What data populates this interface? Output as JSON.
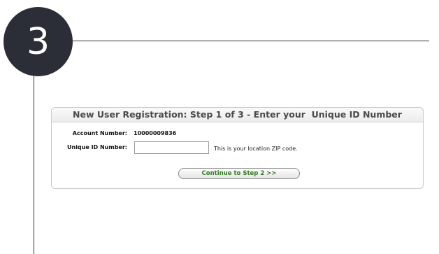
{
  "step_badge": {
    "number": "3"
  },
  "registration": {
    "title": "New User Registration: Step 1 of 3 - Enter your  Unique ID Number",
    "account_label": "Account Number:",
    "account_value": "10000009836",
    "unique_id_label": "Unique ID Number:",
    "unique_id_value": "",
    "unique_id_hint": "This is your location ZIP code.",
    "continue_label": "Continue to Step 2 >>"
  },
  "colors": {
    "badge_background": "#2b2e36",
    "button_text": "#2e7d1e"
  }
}
